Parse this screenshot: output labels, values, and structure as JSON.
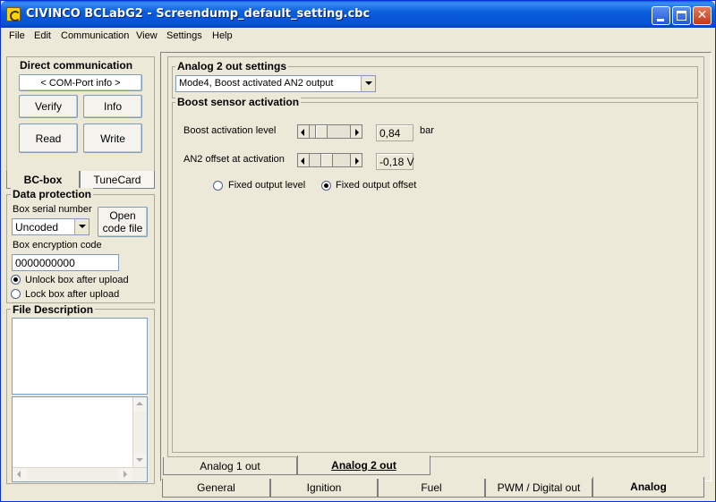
{
  "window": {
    "title": "CIVINCO  BCLabG2 - Screendump_default_setting.cbc"
  },
  "menu": [
    "File",
    "Edit",
    "Communication",
    "View",
    "Settings",
    "Help"
  ],
  "left_panel": {
    "direct_communication": {
      "title": "Direct communication",
      "com_port": "< COM-Port info >",
      "buttons": [
        "Verify",
        "Info",
        "Read",
        "Write"
      ]
    },
    "tabs": [
      "BC-box",
      "TuneCard"
    ],
    "active_tab": "BC-box",
    "data_protection": {
      "title": "Data protection",
      "serial_label": "Box serial number",
      "serial_value": "Uncoded",
      "open_code_button": "Open code file",
      "open_code_line1": "Open",
      "open_code_line2": "code file",
      "encryption_label": "Box encryption code",
      "encryption_value": "0000000000",
      "radio_unlock": "Unlock box after upload",
      "radio_lock": "Lock box after upload",
      "selected": "unlock"
    },
    "file_description": {
      "title": "File Description"
    }
  },
  "main": {
    "analog2_settings": {
      "title": "Analog 2 out settings",
      "mode_value": "Mode4, Boost activated AN2 output"
    },
    "boost_sensor": {
      "title": "Boost sensor activation",
      "boost_level_label": "Boost activation level",
      "boost_level_value": "0,84",
      "boost_level_unit": "bar",
      "an2_offset_label": "AN2 offset at activation",
      "an2_offset_value": "-0,18 V",
      "radio_fixed_level": "Fixed output level",
      "radio_fixed_offset": "Fixed output offset",
      "selected": "offset"
    },
    "sub_tabs": [
      "Analog 1 out",
      "Analog 2 out"
    ],
    "active_sub_tab": "Analog 2 out",
    "bottom_tabs": [
      "General",
      "Ignition",
      "Fuel",
      "PWM / Digital out",
      "Analog"
    ],
    "active_bottom_tab": "Analog"
  }
}
